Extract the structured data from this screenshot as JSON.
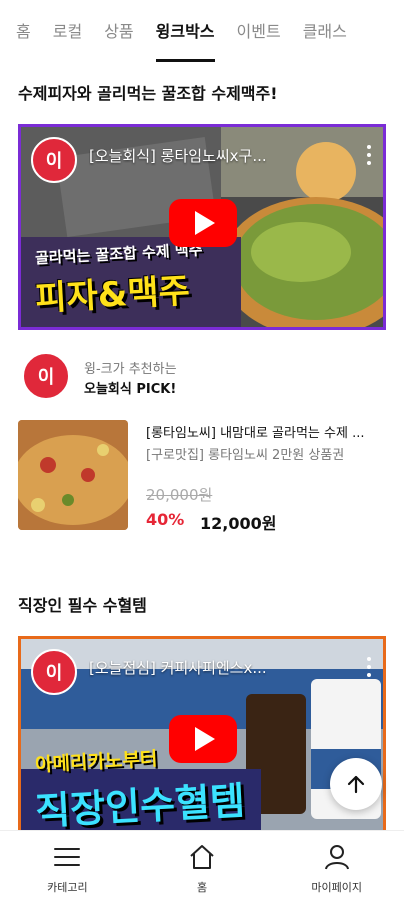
{
  "tabs": [
    {
      "label": "홈"
    },
    {
      "label": "로컬"
    },
    {
      "label": "상품"
    },
    {
      "label": "윙크박스"
    },
    {
      "label": "이벤트"
    },
    {
      "label": "클래스"
    }
  ],
  "active_tab": "윙크박스",
  "section1": {
    "title": "수제피자와 골리먹는 꿀조합 수제맥주!",
    "video": {
      "title": "[오늘회식] 롱타임노씨x구...",
      "logo_text": "이",
      "caption_small": "골라먹는 꿀조합 수제 맥주",
      "caption_big": "피자&맥주"
    },
    "recommender": {
      "sub": "윙-크가 추천하는",
      "main": "오늘회식 PICK!"
    },
    "product": {
      "title": "[롱타임노씨] 내맘대로 골라먹는 수제 ...",
      "store": "[구로맛집] 롱타임노씨 2만원 상품권",
      "original_price": "20,000원",
      "discount": "40%",
      "price": "12,000원"
    }
  },
  "section2": {
    "title": "직장인 필수 수혈템",
    "video": {
      "title": "[오늘점심] 커피사피엔스x...",
      "logo_text": "이",
      "caption_small": "아메리카노부터",
      "caption_big": "직장인수혈템"
    }
  },
  "bottom_nav": [
    {
      "label": "카테고리",
      "icon": "menu-icon"
    },
    {
      "label": "홈",
      "icon": "home-icon"
    },
    {
      "label": "마이페이지",
      "icon": "person-icon"
    }
  ],
  "colors": {
    "accent_purple": "#7b2cd6",
    "accent_orange": "#e86a1a",
    "discount_red": "#e62636",
    "youtube_red": "#ff0000"
  }
}
